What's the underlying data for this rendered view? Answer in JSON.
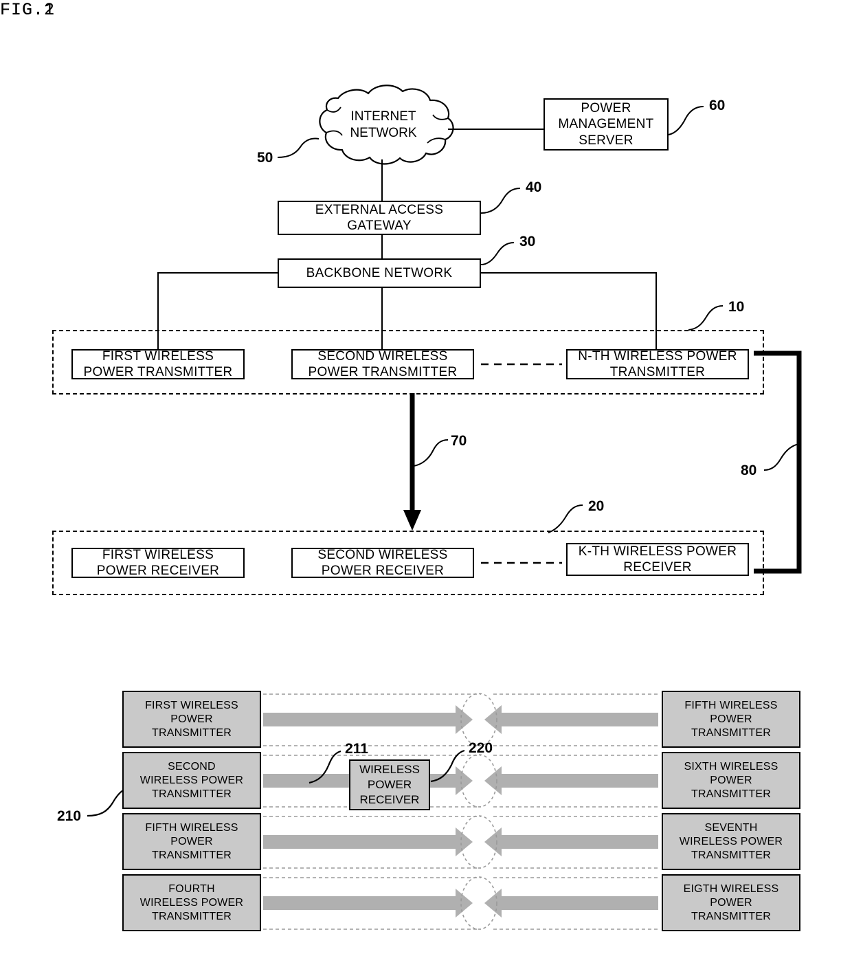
{
  "figures": {
    "fig1": {
      "label": "FIG.1",
      "cloud": {
        "text": "INTERNET\nNETWORK",
        "ref": "50"
      },
      "power_management_server": {
        "text": "POWER\nMANAGEMENT\nSERVER",
        "ref": "60"
      },
      "external_access_gateway": {
        "text": "EXTERNAL ACCESS\nGATEWAY",
        "ref": "40"
      },
      "backbone_network": {
        "text": "BACKBONE NETWORK",
        "ref": "30"
      },
      "transmitter_group": {
        "ref": "10",
        "boxes": [
          {
            "text": "FIRST WIRELESS\nPOWER TRANSMITTER"
          },
          {
            "text": "SECOND WIRELESS\nPOWER TRANSMITTER"
          },
          {
            "text": "N-TH WIRELESS POWER\nTRANSMITTER"
          }
        ]
      },
      "receiver_group": {
        "ref": "20",
        "boxes": [
          {
            "text": "FIRST WIRELESS\nPOWER RECEIVER"
          },
          {
            "text": "SECOND WIRELESS\nPOWER RECEIVER"
          },
          {
            "text": "K-TH WIRELESS POWER\nRECEIVER"
          }
        ]
      },
      "power_transfer_arrow_ref": "70",
      "side_link_ref": "80"
    },
    "fig2": {
      "label": "FIG.2",
      "left_column_ref": "210",
      "beam_ref": "211",
      "receiver_ref": "220",
      "left_boxes": [
        {
          "text": "FIRST WIRELESS\nPOWER\nTRANSMITTER"
        },
        {
          "text": "SECOND\nWIRELESS POWER\nTRANSMITTER"
        },
        {
          "text": "FIFTH WIRELESS\nPOWER\nTRANSMITTER"
        },
        {
          "text": "FOURTH\nWIRELESS POWER\nTRANSMITTER"
        }
      ],
      "right_boxes": [
        {
          "text": "FIFTH WIRELESS\nPOWER\nTRANSMITTER"
        },
        {
          "text": "SIXTH WIRELESS\nPOWER\nTRANSMITTER"
        },
        {
          "text": "SEVENTH\nWIRELESS POWER\nTRANSMITTER"
        },
        {
          "text": "EIGTH WIRELESS\nPOWER\nTRANSMITTER"
        }
      ],
      "receiver_box": {
        "text": "WIRELESS\nPOWER\nRECEIVER"
      }
    }
  },
  "colors": {
    "line": "#000000",
    "box_fill": "#ffffff",
    "tx_fill": "#c9c9c9",
    "beam": "#b0b0b0",
    "lane_guide": "#9a9a9a"
  }
}
